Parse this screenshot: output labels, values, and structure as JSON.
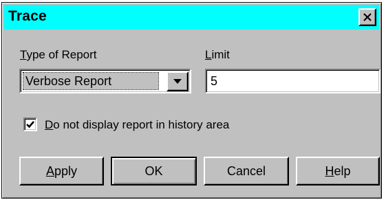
{
  "window": {
    "title": "Trace",
    "close_icon": "close-icon"
  },
  "report_type": {
    "label_hotkey": "T",
    "label_rest": "ype of Report",
    "selected_value": "Verbose Report",
    "arrow_icon": "chevron-down-icon"
  },
  "limit": {
    "label_hotkey": "L",
    "label_rest": "imit",
    "value": "5"
  },
  "history_option": {
    "checked": true,
    "label_hotkey": "D",
    "label_rest": "o not display report in history area"
  },
  "buttons": {
    "apply_hotkey": "A",
    "apply_rest": "pply",
    "ok_label": "OK",
    "cancel_label": "Cancel",
    "help_hotkey": "H",
    "help_rest": "elp"
  },
  "colors": {
    "titlebar": "#00ffff",
    "dialog_face": "#c0c0c0"
  }
}
